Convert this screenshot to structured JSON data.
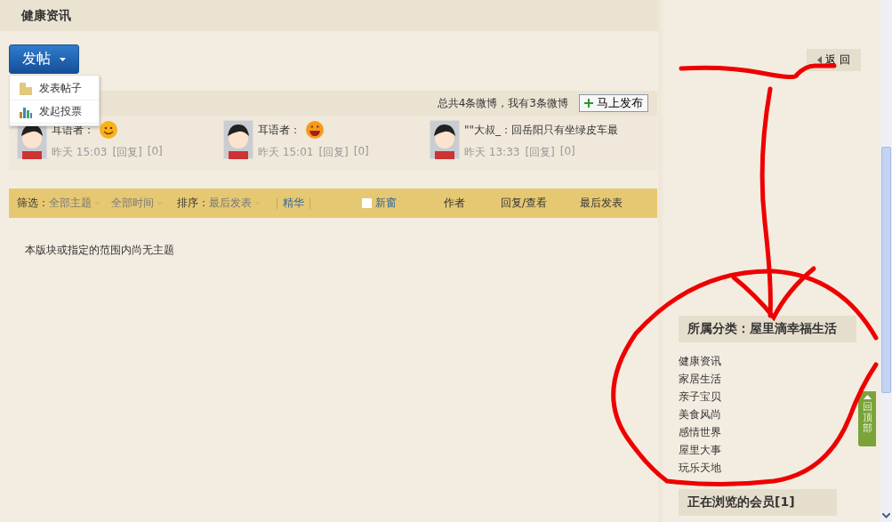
{
  "header": {
    "title": "健康资讯"
  },
  "post_button": {
    "label": "发帖",
    "expanded": true
  },
  "post_menu": [
    {
      "label": "发表帖子",
      "kind": "post"
    },
    {
      "label": "发起投票",
      "kind": "poll"
    }
  ],
  "back_button": {
    "label": "返 回"
  },
  "microblog": {
    "summary": "总共4条微博，我有3条微博",
    "publish_button": "马上发布",
    "items": [
      {
        "text": "耳语者：",
        "kind": "smiley",
        "time": "昨天 15:03",
        "reply": "[回复]",
        "count": "[0]"
      },
      {
        "text": "耳语者：",
        "kind": "grin",
        "time": "昨天 15:01",
        "reply": "[回复]",
        "count": "[0]"
      },
      {
        "kind": "text",
        "text": "\"\"大叔_：回岳阳只有坐绿皮车最",
        "time": "昨天 13:33",
        "reply": "[回复]",
        "count": "[0]"
      }
    ]
  },
  "filter_bar": {
    "filter_label": "筛选：",
    "filters": [
      "全部主题",
      "全部时间"
    ],
    "sort_label": "排序：",
    "sort": "最后发表",
    "digest": "精华",
    "new_window": {
      "label": "新窗",
      "checked": false
    },
    "columns": [
      "作者",
      "回复/查看",
      "最后发表"
    ]
  },
  "empty_message": "本版块或指定的范围内尚无主题",
  "sidebar": {
    "category_title": "所属分类：屋里滴幸福生活",
    "categories": [
      "健康资讯",
      "家居生活",
      "亲子宝贝",
      "美食风尚",
      "感情世界",
      "屋里大事",
      "玩乐天地"
    ],
    "members_title": "正在浏览的会员[1]"
  },
  "back_to_top": {
    "label": "回顶部"
  }
}
